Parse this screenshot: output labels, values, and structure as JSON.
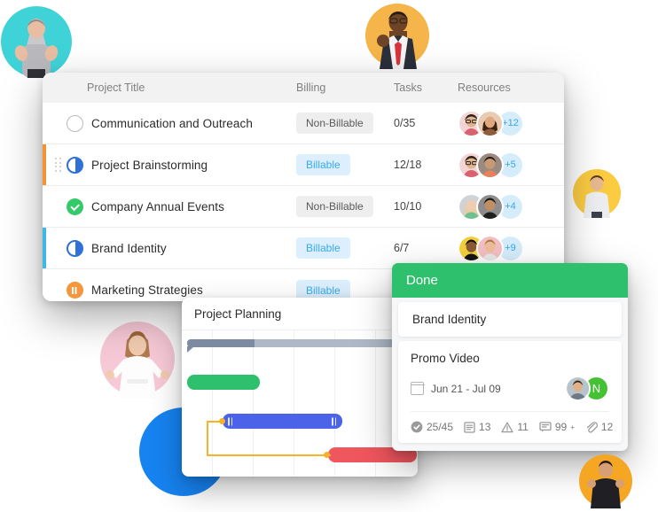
{
  "table": {
    "headers": {
      "title": "Project Title",
      "billing": "Billing",
      "tasks": "Tasks",
      "resources": "Resources"
    },
    "rows": [
      {
        "status": "not-started",
        "accent": "",
        "title": "Communication and Outreach",
        "billing": "Non-Billable",
        "billing_type": "non-billable",
        "tasks": "0/35",
        "extra_members": "+12",
        "avatars": [
          "#f3d5d5",
          "#e8cbb0"
        ]
      },
      {
        "status": "in-progress",
        "accent": "#f5932e",
        "title": "Project Brainstorming",
        "billing": "Billable",
        "billing_type": "billable",
        "tasks": "12/18",
        "extra_members": "+5",
        "avatars": [
          "#f3d5d5",
          "#9b8a80"
        ]
      },
      {
        "status": "done",
        "accent": "",
        "title": "Company Annual Events",
        "billing": "Non-Billable",
        "billing_type": "non-billable",
        "tasks": "10/10",
        "extra_members": "+4",
        "avatars": [
          "#e3cfa8",
          "#8d8d8d"
        ]
      },
      {
        "status": "in-progress",
        "accent": "#3ab9e8",
        "title": "Brand Identity",
        "billing": "Billable",
        "billing_type": "billable",
        "tasks": "6/7",
        "extra_members": "+9",
        "avatars": [
          "#f2d03c",
          "#f4bfc2"
        ]
      },
      {
        "status": "paused",
        "accent": "",
        "title": "Marketing Strategies",
        "billing": "Billable",
        "billing_type": "billable",
        "tasks": "",
        "extra_members": "",
        "avatars": []
      }
    ]
  },
  "gantt": {
    "title": "Project Planning",
    "bars": [
      {
        "name": "summary",
        "color": "#7c8ba1"
      },
      {
        "name": "task-green",
        "color": "#2ec06d"
      },
      {
        "name": "task-blue",
        "color": "#4a63e8"
      },
      {
        "name": "task-red",
        "color": "#f0565e"
      }
    ],
    "link_color": "#f5b32a"
  },
  "done_card": {
    "column_title": "Done",
    "column_color": "#2ec06d",
    "parent_task": "Brand Identity",
    "parent_stripe_color": "#e8433f",
    "task_title": "Promo Video",
    "date_range": "Jun 21 - Jul 09",
    "assignee_initial": "N",
    "assignee_color": "#45c234",
    "stats": {
      "subtasks": "25/45",
      "notes": "13",
      "issues": "11",
      "comments": "99",
      "comments_suffix": "+",
      "attachments": "12"
    }
  },
  "avatars": {
    "top_left": {
      "bg": "#3fd3d8",
      "name": "man-thumbs-up"
    },
    "top_center": {
      "bg": "#f5b54a",
      "name": "man-in-suit"
    },
    "mid_right": {
      "bg": "#fbcb41",
      "name": "man-casual"
    },
    "bottom_left": {
      "bg": "#f7c9d6",
      "name": "woman-celebrating"
    },
    "bottom_right": {
      "bg": "#f5a623",
      "name": "man-black-shirt"
    },
    "blue_circle": {
      "bg": "#1683f0",
      "name": "decorative-blue-circle"
    }
  }
}
